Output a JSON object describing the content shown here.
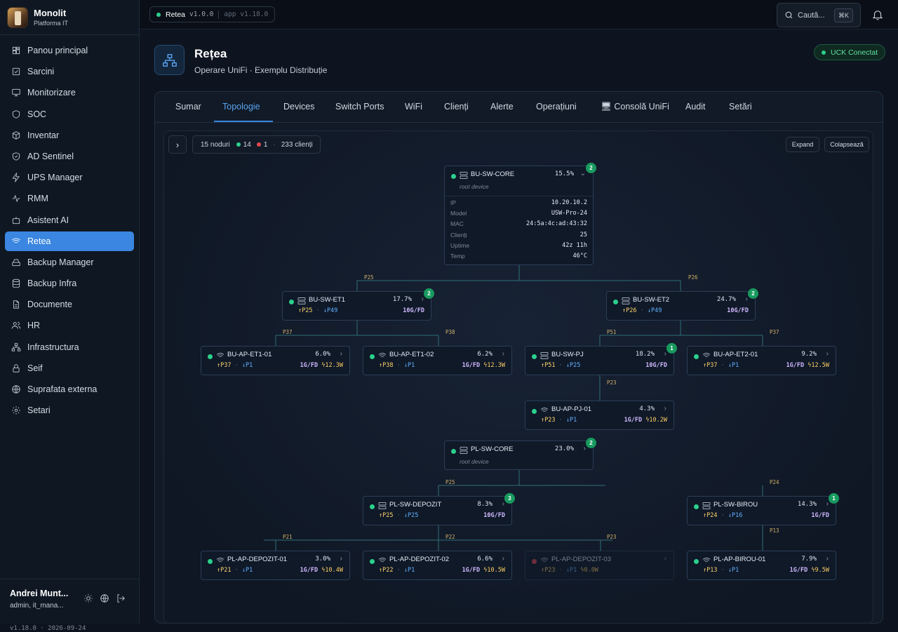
{
  "app": {
    "name": "Monolit",
    "subtitle": "Platforma IT"
  },
  "sidebar": {
    "items": [
      {
        "label": "Panou principal",
        "icon": "home-icon"
      },
      {
        "label": "Sarcini",
        "icon": "checkbox-icon"
      },
      {
        "label": "Monitorizare",
        "icon": "monitor-icon"
      },
      {
        "label": "SOC",
        "icon": "shield-icon"
      },
      {
        "label": "Inventar",
        "icon": "box-icon"
      },
      {
        "label": "AD Sentinel",
        "icon": "shield-check-icon"
      },
      {
        "label": "UPS Manager",
        "icon": "bolt-icon"
      },
      {
        "label": "RMM",
        "icon": "pulse-icon"
      },
      {
        "label": "Asistent AI",
        "icon": "bot-icon"
      },
      {
        "label": "Retea",
        "icon": "wifi-icon",
        "active": true
      },
      {
        "label": "Backup Manager",
        "icon": "hard-drive-icon"
      },
      {
        "label": "Backup Infra",
        "icon": "database-icon"
      },
      {
        "label": "Documente",
        "icon": "file-icon"
      },
      {
        "label": "HR",
        "icon": "users-icon"
      },
      {
        "label": "Infrastructura",
        "icon": "network-icon"
      },
      {
        "label": "Seif",
        "icon": "lock-icon"
      },
      {
        "label": "Suprafata externa",
        "icon": "globe-icon"
      },
      {
        "label": "Setari",
        "icon": "gear-icon"
      }
    ]
  },
  "user": {
    "name": "Andrei Munt...",
    "role": "admin, it_mana...",
    "version": "v1.18.0 · 2026-09-24"
  },
  "topbar": {
    "module": "Retea",
    "module_version": "v1.0.0",
    "app_version": "app v1.18.0",
    "search_placeholder": "Caută...",
    "shortcut": "⌘K"
  },
  "header": {
    "title": "Rețea",
    "subtitle": "Operare UniFi · Exemplu Distribuție",
    "status": "UCK Conectat"
  },
  "tabs": [
    "Sumar",
    "Topologie",
    "Devices",
    "Switch Ports",
    "WiFi",
    "Clienți",
    "Alerte",
    "Operațiuni",
    "🖥 Consolă UniFi",
    "Audit",
    "Setări"
  ],
  "active_tab": "Topologie",
  "toolbar": {
    "nodes": "15 noduri",
    "online": "14",
    "offline": "1",
    "clients": "233 clienți",
    "expand": "Expand",
    "collapse": "Colapsează"
  },
  "colors": {
    "accent": "#3a86e0",
    "online": "#2bd08c",
    "offline": "#e0484f",
    "badge": "#189a5f"
  },
  "core_details": [
    {
      "label": "IP",
      "value": "10.20.10.2"
    },
    {
      "label": "Model",
      "value": "USW-Pro-24"
    },
    {
      "label": "MAC",
      "value": "24:5a:4c:ad:43:32"
    },
    {
      "label": "Clienți",
      "value": "25"
    },
    {
      "label": "Uptime",
      "value": "42z 11h"
    },
    {
      "label": "Temp",
      "value": "46°C"
    }
  ],
  "nodes": {
    "bu_core": {
      "name": "BU-SW-CORE",
      "type": "switch",
      "cpu": "15.5%",
      "root": "root device",
      "badge": "2"
    },
    "bu_et1": {
      "name": "BU-SW-ET1",
      "type": "switch",
      "cpu": "17.7%",
      "up": "↑P25",
      "down": "↓P49",
      "link": "10G/FD",
      "badge": "2"
    },
    "bu_et2": {
      "name": "BU-SW-ET2",
      "type": "switch",
      "cpu": "24.7%",
      "up": "↑P26",
      "down": "↓P49",
      "link": "10G/FD",
      "badge": "2"
    },
    "bu_ap_et1_01": {
      "name": "BU-AP-ET1-01",
      "type": "ap",
      "cpu": "6.0%",
      "up": "↑P37",
      "down": "↓P1",
      "link": "1G/FD",
      "power": "12.3W"
    },
    "bu_ap_et1_02": {
      "name": "BU-AP-ET1-02",
      "type": "ap",
      "cpu": "6.2%",
      "up": "↑P38",
      "down": "↓P1",
      "link": "1G/FD",
      "power": "12.3W"
    },
    "bu_sw_pj": {
      "name": "BU-SW-PJ",
      "type": "switch",
      "cpu": "18.2%",
      "up": "↑P51",
      "down": "↓P25",
      "link": "10G/FD",
      "badge": "1"
    },
    "bu_ap_et2_01": {
      "name": "BU-AP-ET2-01",
      "type": "ap",
      "cpu": "9.2%",
      "up": "↑P37",
      "down": "↓P1",
      "link": "1G/FD",
      "power": "12.5W"
    },
    "bu_ap_pj_01": {
      "name": "BU-AP-PJ-01",
      "type": "ap",
      "cpu": "4.3%",
      "up": "↑P23",
      "down": "↓P1",
      "link": "1G/FD",
      "power": "10.2W"
    },
    "pl_core": {
      "name": "PL-SW-CORE",
      "type": "switch",
      "cpu": "23.0%",
      "root": "root device",
      "badge": "2"
    },
    "pl_depozit": {
      "name": "PL-SW-DEPOZIT",
      "type": "switch",
      "cpu": "8.3%",
      "up": "↑P25",
      "down": "↓P25",
      "link": "10G/FD",
      "badge": "3"
    },
    "pl_birou": {
      "name": "PL-SW-BIROU",
      "type": "switch",
      "cpu": "14.3%",
      "up": "↑P24",
      "down": "↓P16",
      "link": "1G/FD",
      "badge": "1"
    },
    "pl_ap_dep_01": {
      "name": "PL-AP-DEPOZIT-01",
      "type": "ap",
      "cpu": "3.0%",
      "up": "↑P21",
      "down": "↓P1",
      "link": "1G/FD",
      "power": "10.4W"
    },
    "pl_ap_dep_02": {
      "name": "PL-AP-DEPOZIT-02",
      "type": "ap",
      "cpu": "6.6%",
      "up": "↑P22",
      "down": "↓P1",
      "link": "1G/FD",
      "power": "10.5W"
    },
    "pl_ap_dep_03": {
      "name": "PL-AP-DEPOZIT-03",
      "type": "ap",
      "offline": true,
      "up": "↑P23",
      "down": "↓P1",
      "power": "0.0W"
    },
    "pl_ap_birou_01": {
      "name": "PL-AP-BIROU-01",
      "type": "ap",
      "cpu": "7.9%",
      "up": "↑P13",
      "down": "↓P1",
      "link": "1G/FD",
      "power": "9.5W"
    }
  },
  "port_labels": [
    "P25",
    "P26",
    "P37",
    "P38",
    "P51",
    "P37",
    "P23",
    "P25",
    "P24",
    "P21",
    "P22",
    "P23",
    "P13"
  ]
}
